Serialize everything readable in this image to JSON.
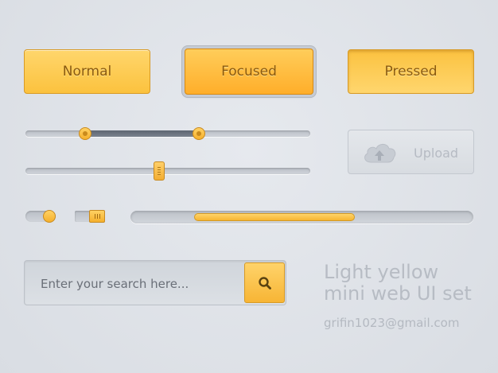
{
  "buttons": {
    "normal": "Normal",
    "focused": "Focused",
    "pressed": "Pressed"
  },
  "range_slider": {
    "low": 0.21,
    "high": 0.61
  },
  "single_slider": {
    "value": 0.47
  },
  "upload": {
    "label": "Upload",
    "icon": "cloud-upload-icon"
  },
  "toggle": {
    "state": "on"
  },
  "switch": {
    "state": "on"
  },
  "progress": {
    "value": 0.47
  },
  "search": {
    "placeholder": "Enter your search here...",
    "icon": "search-icon"
  },
  "branding": {
    "title_line1": "Light yellow",
    "title_line2": "mini web UI set",
    "email": "grifin1023@gmail.com"
  },
  "colors": {
    "accent": "#fbc23e",
    "accent_border": "#d89a25",
    "background": "#dfe3e8"
  }
}
